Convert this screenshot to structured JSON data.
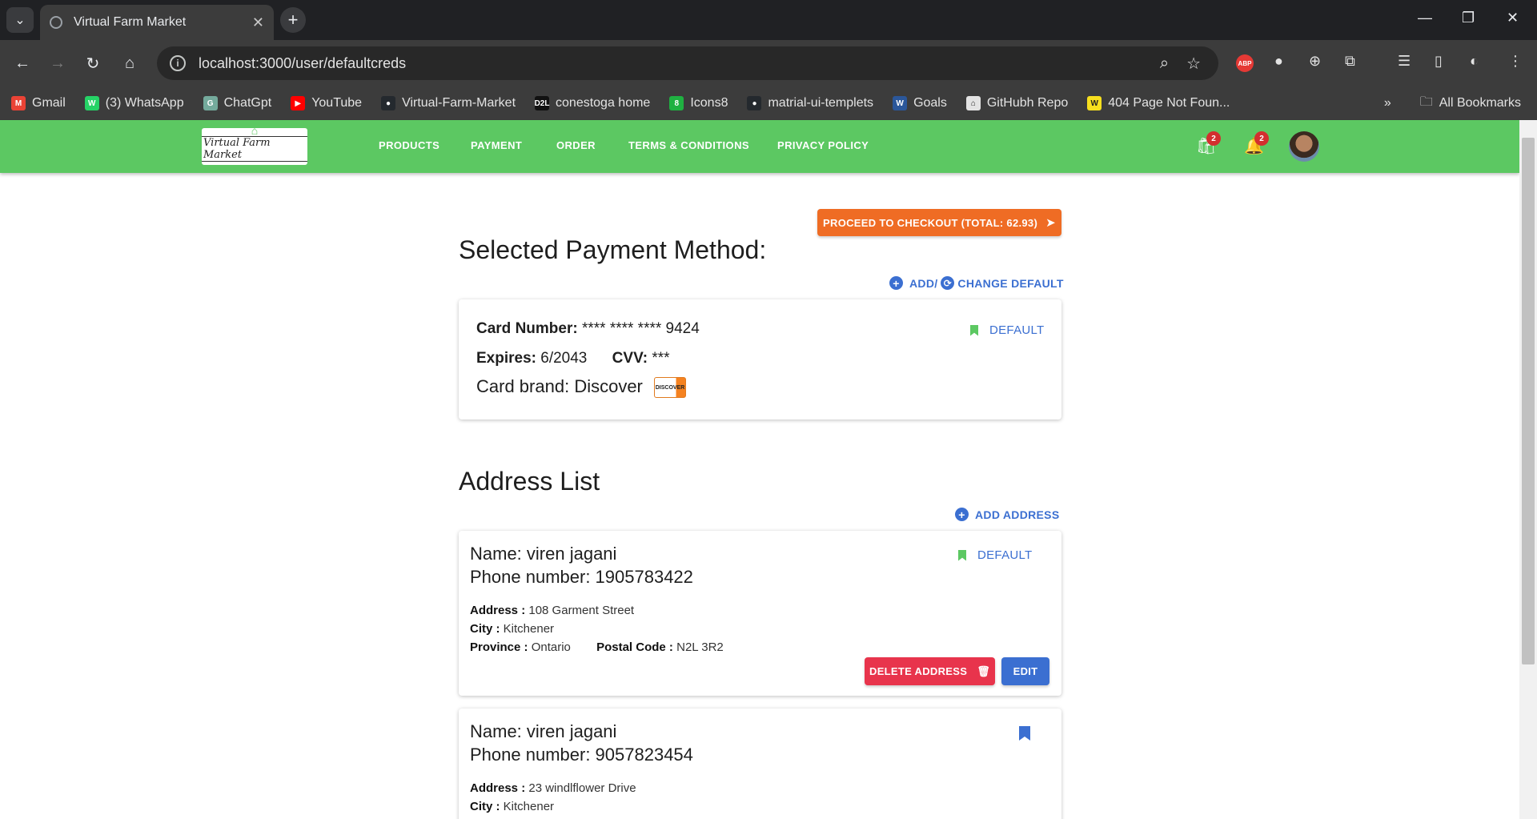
{
  "browser": {
    "tab_title": "Virtual Farm Market",
    "url": "localhost:3000/user/defaultcreds",
    "bookmarks": [
      {
        "label": "Gmail",
        "color": "#ea4335",
        "glyph": "M"
      },
      {
        "label": "(3) WhatsApp",
        "color": "#25d366",
        "glyph": "W"
      },
      {
        "label": "ChatGpt",
        "color": "#74aa9c",
        "glyph": "G"
      },
      {
        "label": "YouTube",
        "color": "#ff0000",
        "glyph": "▶"
      },
      {
        "label": "Virtual-Farm-Market",
        "color": "#24292e",
        "glyph": "●"
      },
      {
        "label": "conestoga home",
        "color": "#111111",
        "glyph": "D2L"
      },
      {
        "label": "Icons8",
        "color": "#1fb141",
        "glyph": "8"
      },
      {
        "label": "matrial-ui-templets",
        "color": "#24292e",
        "glyph": "●"
      },
      {
        "label": "Goals",
        "color": "#2b579a",
        "glyph": "W"
      },
      {
        "label": "GitHubh Repo",
        "color": "#e3e3e3",
        "glyph": "⌂"
      },
      {
        "label": "404 Page Not Foun...",
        "color": "#f7df1e",
        "glyph": "W"
      }
    ],
    "all_bookmarks": "All Bookmarks"
  },
  "nav": {
    "logo_text": "Virtual Farm Market",
    "links": [
      "PRODUCTS",
      "PAYMENT",
      "ORDER",
      "TERMS & CONDITIONS",
      "PRIVACY POLICY"
    ],
    "cart_count": "2",
    "notif_count": "2"
  },
  "payment": {
    "checkout_label": "PROCEED TO CHECKOUT (TOTAL: 62.93)",
    "heading": "Selected Payment Method:",
    "add_label": "ADD/",
    "change_label": "CHANGE DEFAULT",
    "card_number_label": "Card Number:",
    "card_number": "**** **** **** 9424",
    "expires_label": "Expires:",
    "expires": "6/2043",
    "cvv_label": "CVV:",
    "cvv": "***",
    "brand_label": "Card brand:",
    "brand": "Discover",
    "brand_logo": "DISCOVER",
    "default_label": "DEFAULT"
  },
  "addresses": {
    "heading": "Address List",
    "add_label": "ADD ADDRESS",
    "address_label": "Address :",
    "city_label": "City :",
    "province_label": "Province :",
    "postal_label": "Postal Code :",
    "delete_label": "DELETE ADDRESS",
    "edit_label": "EDIT",
    "default_label": "DEFAULT",
    "items": [
      {
        "name": "Name: viren jagani",
        "phone": "Phone number: 1905783422",
        "address": "108 Garment Street",
        "city": "Kitchener",
        "province": "Ontario",
        "postal": "N2L 3R2"
      },
      {
        "name": "Name: viren jagani",
        "phone": "Phone number: 9057823454",
        "address": "23 windlflower Drive",
        "city": "Kitchener"
      }
    ]
  }
}
